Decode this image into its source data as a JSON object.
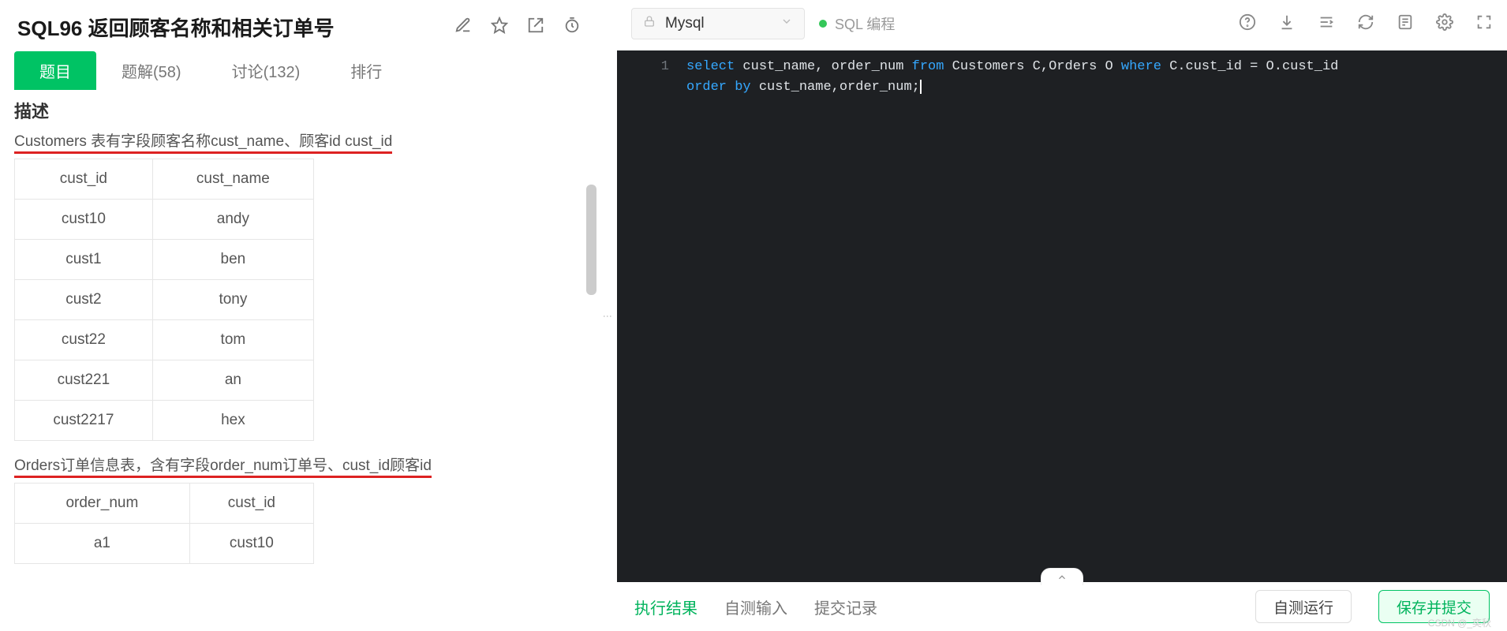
{
  "header": {
    "title": "SQL96  返回顾客名称和相关订单号"
  },
  "tabs": {
    "problem": "题目",
    "solution": "题解(58)",
    "discuss": "讨论(132)",
    "rank": "排行"
  },
  "description": {
    "heading": "描述",
    "para1": "Customers 表有字段顾客名称cust_name、顾客id cust_id",
    "table1": {
      "headers": [
        "cust_id",
        "cust_name"
      ],
      "rows": [
        [
          "cust10",
          "andy"
        ],
        [
          "cust1",
          "ben"
        ],
        [
          "cust2",
          "tony"
        ],
        [
          "cust22",
          "tom"
        ],
        [
          "cust221",
          "an"
        ],
        [
          "cust2217",
          "hex"
        ]
      ]
    },
    "para2": "Orders订单信息表，含有字段order_num订单号、cust_id顾客id",
    "table2": {
      "headers": [
        "order_num",
        "cust_id"
      ],
      "rows": [
        [
          "a1",
          "cust10"
        ]
      ]
    }
  },
  "editor_bar": {
    "language": "Mysql",
    "mode": "SQL 编程"
  },
  "code": {
    "line_no": "1",
    "tokens": {
      "select": "select",
      "cols": " cust_name, order_num ",
      "from": "from",
      "tables": " Customers C,Orders O ",
      "where": "where",
      "cond": " C.cust_id = O.cust_id",
      "order": "order",
      "by": "by",
      "ordercols": " cust_name,order_num;"
    }
  },
  "bottom": {
    "result": "执行结果",
    "selftest": "自测输入",
    "history": "提交记录",
    "run": "自测运行",
    "submit": "保存并提交"
  },
  "watermark": "CSDN @_奕秋"
}
